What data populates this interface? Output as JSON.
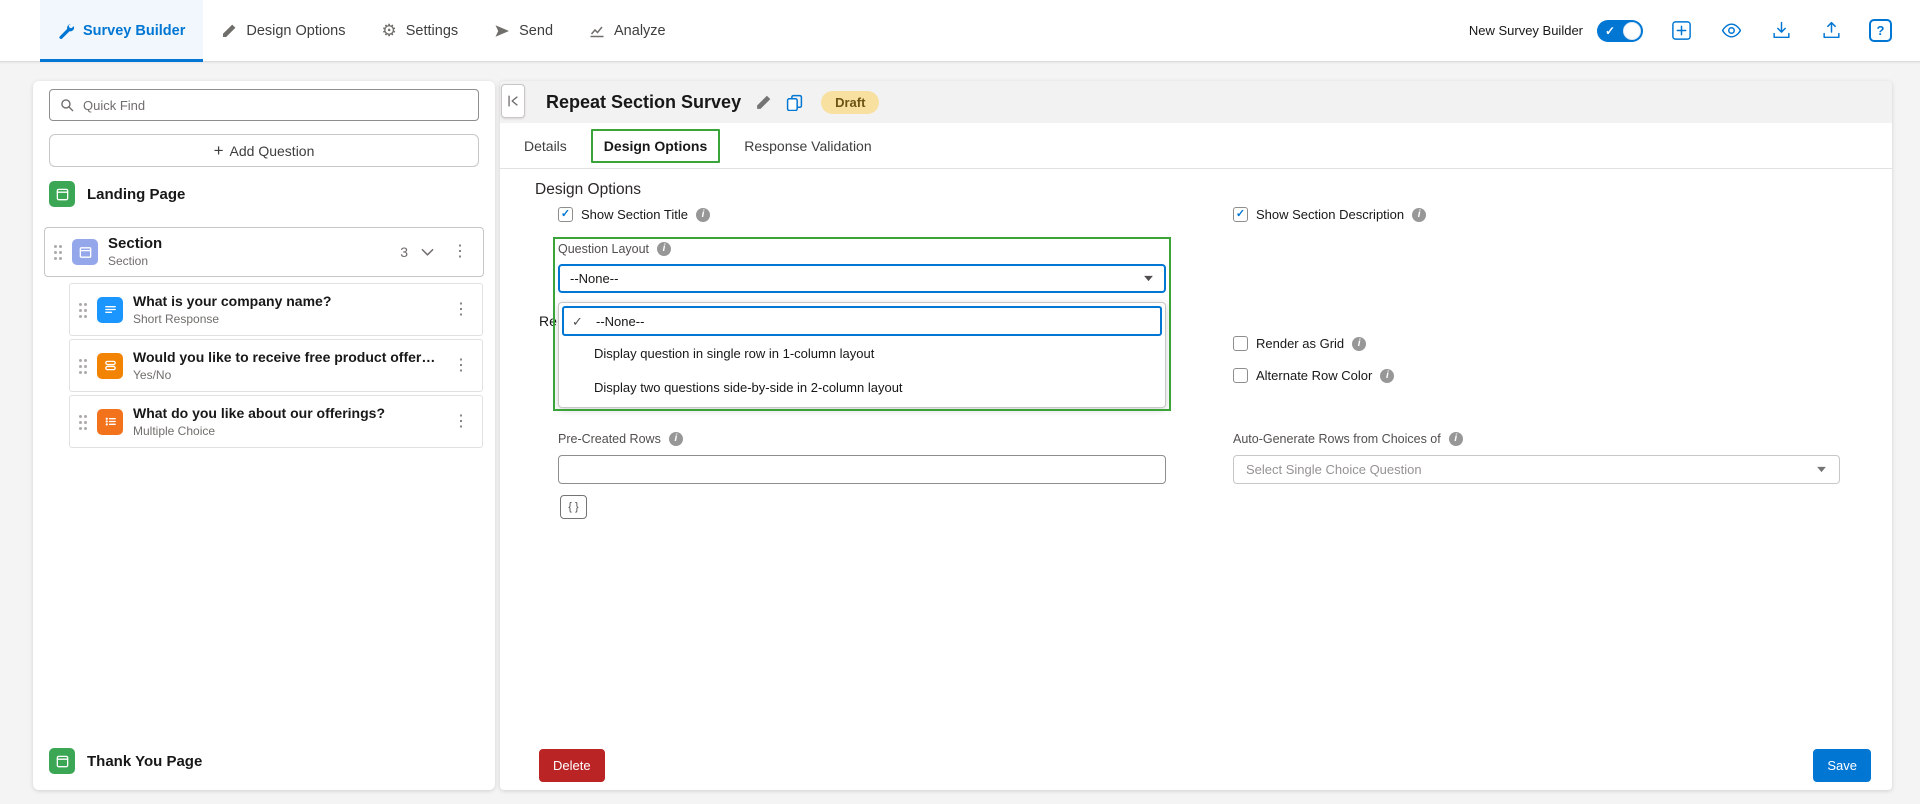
{
  "top_nav": {
    "tabs": [
      {
        "label": "Survey Builder"
      },
      {
        "label": "Design Options"
      },
      {
        "label": "Settings"
      },
      {
        "label": "Send"
      },
      {
        "label": "Analyze"
      }
    ],
    "new_builder_label": "New Survey Builder"
  },
  "sidebar": {
    "search_placeholder": "Quick Find",
    "add_question_label": "Add Question",
    "landing_page_label": "Landing Page",
    "section": {
      "title": "Section",
      "subtitle": "Section",
      "count": "3"
    },
    "questions": [
      {
        "title": "What is your company name?",
        "type": "Short Response"
      },
      {
        "title": "Would you like to receive free product offers v...",
        "type": "Yes/No"
      },
      {
        "title": "What do you like about our offerings?",
        "type": "Multiple Choice"
      }
    ],
    "thank_you_label": "Thank You Page"
  },
  "main": {
    "title": "Repeat Section Survey",
    "status_badge": "Draft",
    "tabs": [
      {
        "label": "Details"
      },
      {
        "label": "Design Options"
      },
      {
        "label": "Response Validation"
      }
    ],
    "active_tab": "Design Options",
    "section_heading": "Design Options",
    "fields": {
      "show_section_title": "Show Section Title",
      "show_section_description": "Show Section Description",
      "question_layout_label": "Question Layout",
      "question_layout_value": "--None--",
      "question_layout": {
        "options": [
          "--None--",
          "Display question in single row in 1-column layout",
          "Display two questions side-by-side in 2-column layout"
        ],
        "selected_option": "--None--"
      },
      "partial_label": "Re",
      "render_as_grid": "Render as Grid",
      "alternate_row_color": "Alternate Row Color",
      "pre_created_rows_label": "Pre-Created Rows",
      "pre_created_rows_value": "",
      "merge_button": "{ }",
      "auto_generate_label": "Auto-Generate Rows from Choices of",
      "auto_generate_placeholder": "Select Single Choice Question"
    },
    "delete_label": "Delete",
    "save_label": "Save"
  },
  "icons": {
    "check": "✓",
    "gear": "⚙",
    "kebab": "⋮",
    "plus": "+",
    "help": "?",
    "info": "i"
  },
  "colors": {
    "accent_blue": "#0176d3",
    "annotation_green": "#3aa33a",
    "delete_red": "#ba2424",
    "draft_badge_bg": "#f7e0a0",
    "landing_icon_green": "#3ba755",
    "section_icon_periwinkle": "#94a7ea",
    "short_response_icon_blue": "#1b96ff",
    "yes_no_icon_orange": "#f38303",
    "multiple_choice_icon_orange": "#f3731d"
  }
}
